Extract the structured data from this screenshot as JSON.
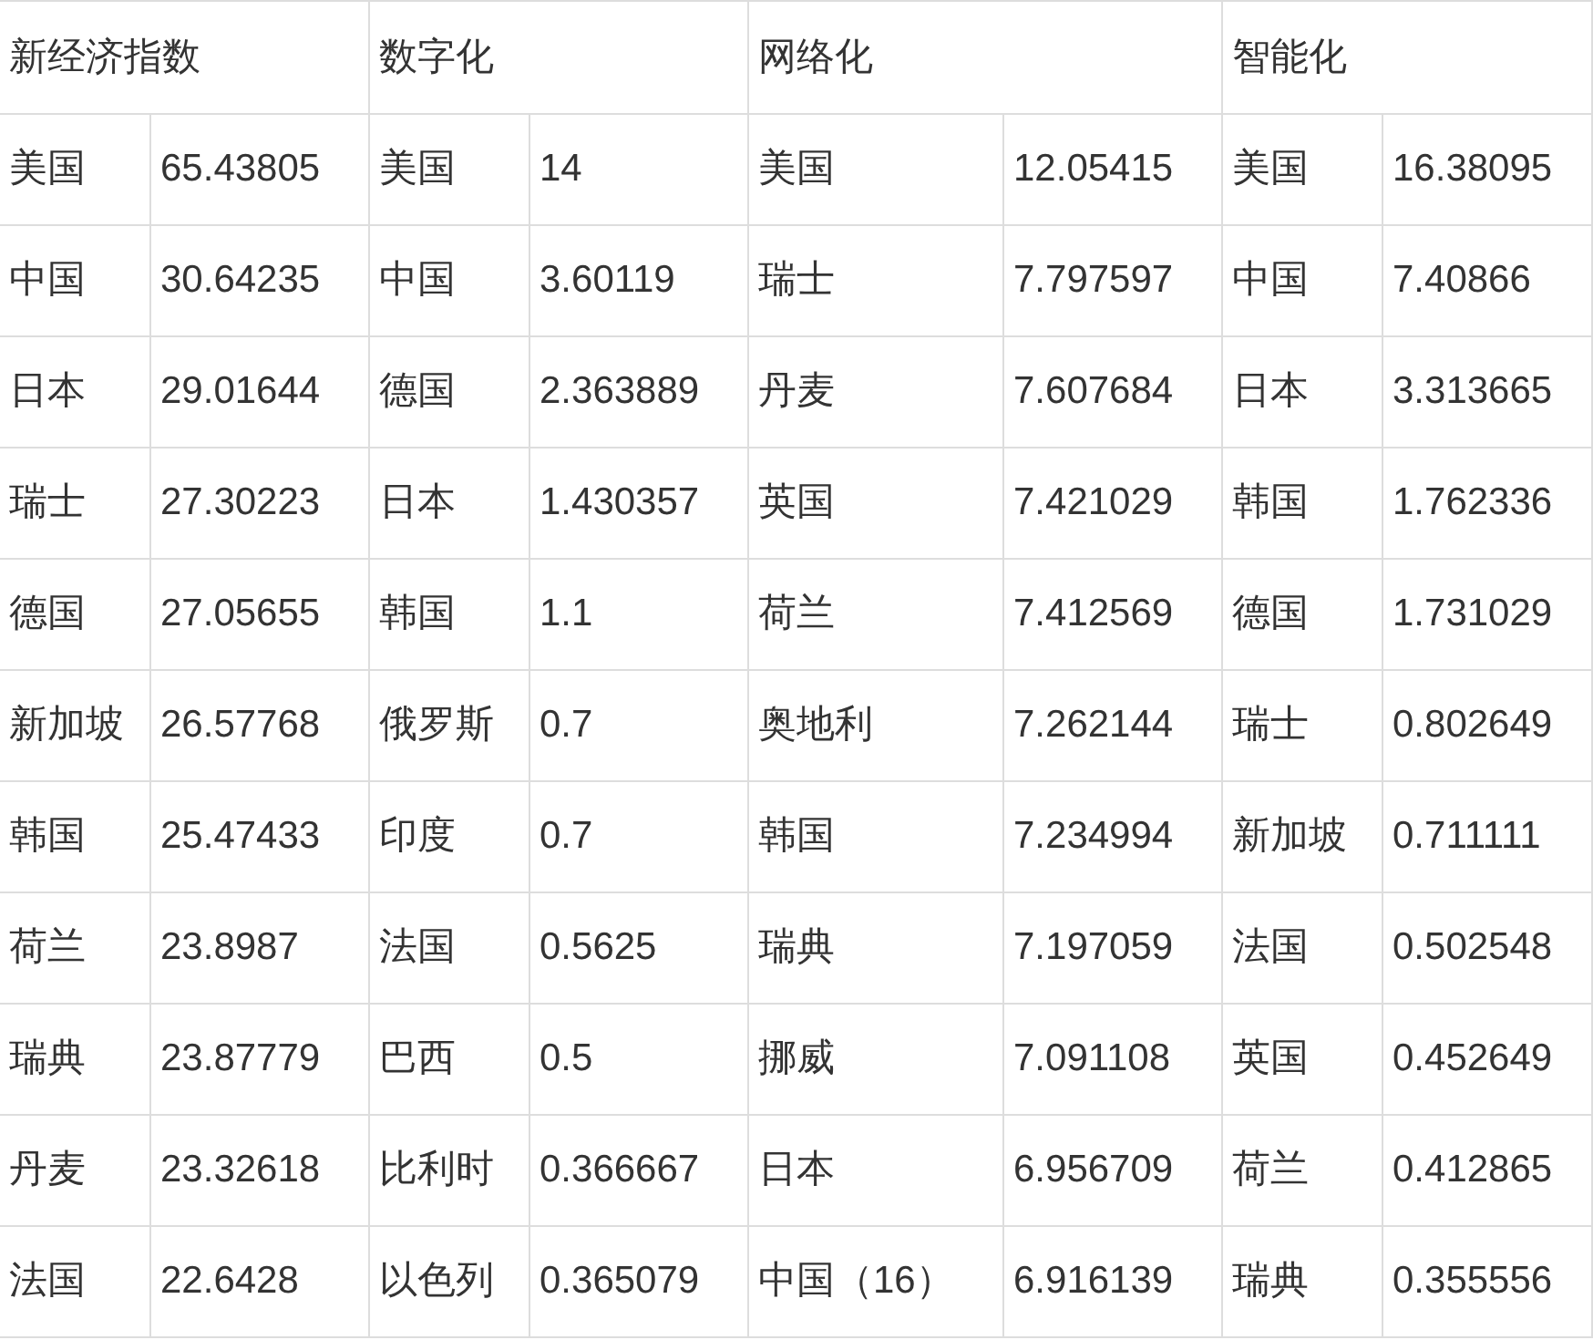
{
  "table": {
    "headers": [
      "新经济指数",
      "数字化",
      "网络化",
      "智能化"
    ],
    "rows": [
      {
        "cells": [
          "美国",
          "65.43805",
          "美国",
          "14",
          "美国",
          "12.05415",
          "美国",
          "16.38095"
        ]
      },
      {
        "cells": [
          "中国",
          "30.64235",
          "中国",
          "3.60119",
          "瑞士",
          "7.797597",
          "中国",
          "7.40866"
        ]
      },
      {
        "cells": [
          "日本",
          "29.01644",
          "德国",
          "2.363889",
          "丹麦",
          "7.607684",
          "日本",
          "3.313665"
        ]
      },
      {
        "cells": [
          "瑞士",
          "27.30223",
          "日本",
          "1.430357",
          "英国",
          "7.421029",
          "韩国",
          "1.762336"
        ]
      },
      {
        "cells": [
          "德国",
          "27.05655",
          "韩国",
          "1.1",
          "荷兰",
          "7.412569",
          "德国",
          "1.731029"
        ]
      },
      {
        "cells": [
          "新加坡",
          "26.57768",
          "俄罗斯",
          "0.7",
          "奥地利",
          "7.262144",
          "瑞士",
          "0.802649"
        ]
      },
      {
        "cells": [
          "韩国",
          "25.47433",
          "印度",
          "0.7",
          "韩国",
          "7.234994",
          "新加坡",
          "0.711111"
        ]
      },
      {
        "cells": [
          "荷兰",
          "23.8987",
          "法国",
          "0.5625",
          "瑞典",
          "7.197059",
          "法国",
          "0.502548"
        ]
      },
      {
        "cells": [
          "瑞典",
          "23.87779",
          "巴西",
          "0.5",
          "挪威",
          "7.091108",
          "英国",
          "0.452649"
        ]
      },
      {
        "cells": [
          "丹麦",
          "23.32618",
          "比利时",
          "0.366667",
          "日本",
          "6.956709",
          "荷兰",
          "0.412865"
        ]
      },
      {
        "cells": [
          "法国",
          "22.6428",
          "以色列",
          "0.365079",
          "中国（16）",
          "6.916139",
          "瑞典",
          "0.355556"
        ]
      }
    ]
  }
}
